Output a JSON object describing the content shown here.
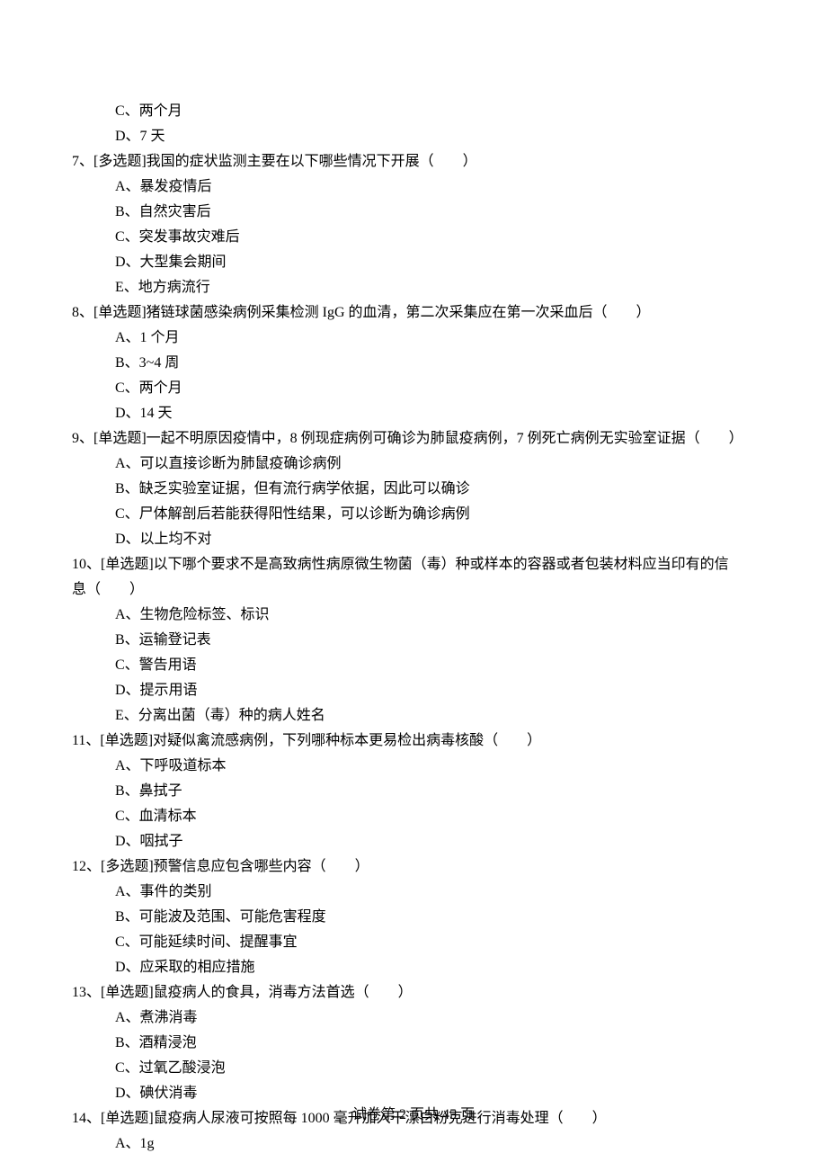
{
  "q6_tail": {
    "options": [
      {
        "label": "C、两个月"
      },
      {
        "label": "D、7 天"
      }
    ]
  },
  "q7": {
    "stem": "7、[多选题]我国的症状监测主要在以下哪些情况下开展（　　）",
    "options": [
      {
        "label": "A、暴发疫情后"
      },
      {
        "label": "B、自然灾害后"
      },
      {
        "label": "C、突发事故灾难后"
      },
      {
        "label": "D、大型集会期间"
      },
      {
        "label": "E、地方病流行"
      }
    ]
  },
  "q8": {
    "stem": "8、[单选题]猪链球菌感染病例采集检测 IgG 的血清，第二次采集应在第一次采血后（　　）",
    "options": [
      {
        "label": "A、1 个月"
      },
      {
        "label": "B、3~4 周"
      },
      {
        "label": "C、两个月"
      },
      {
        "label": "D、14 天"
      }
    ]
  },
  "q9": {
    "stem": "9、[单选题]一起不明原因疫情中，8 例现症病例可确诊为肺鼠疫病例，7 例死亡病例无实验室证据（　　）",
    "options": [
      {
        "label": "A、可以直接诊断为肺鼠疫确诊病例"
      },
      {
        "label": "B、缺乏实验室证据，但有流行病学依据，因此可以确诊"
      },
      {
        "label": "C、尸体解剖后若能获得阳性结果，可以诊断为确诊病例"
      },
      {
        "label": "D、以上均不对"
      }
    ]
  },
  "q10": {
    "stem_line1": "10、[单选题]以下哪个要求不是高致病性病原微生物菌（毒）种或样本的容器或者包装材料应当印有的信",
    "stem_line2": "息（　　）",
    "options": [
      {
        "label": "A、生物危险标签、标识"
      },
      {
        "label": "B、运输登记表"
      },
      {
        "label": "C、警告用语"
      },
      {
        "label": "D、提示用语"
      },
      {
        "label": "E、分离出菌（毒）种的病人姓名"
      }
    ]
  },
  "q11": {
    "stem": "11、[单选题]对疑似禽流感病例，下列哪种标本更易检出病毒核酸（　　）",
    "options": [
      {
        "label": "A、下呼吸道标本"
      },
      {
        "label": "B、鼻拭子"
      },
      {
        "label": "C、血清标本"
      },
      {
        "label": "D、咽拭子"
      }
    ]
  },
  "q12": {
    "stem": "12、[多选题]预警信息应包含哪些内容（　　）",
    "options": [
      {
        "label": "A、事件的类别"
      },
      {
        "label": "B、可能波及范围、可能危害程度"
      },
      {
        "label": "C、可能延续时间、提醒事宜"
      },
      {
        "label": "D、应采取的相应措施"
      }
    ]
  },
  "q13": {
    "stem": "13、[单选题]鼠疫病人的食具，消毒方法首选（　　）",
    "options": [
      {
        "label": "A、煮沸消毒"
      },
      {
        "label": "B、酒精浸泡"
      },
      {
        "label": "C、过氧乙酸浸泡"
      },
      {
        "label": "D、碘伏消毒"
      }
    ]
  },
  "q14": {
    "stem": "14、[单选题]鼠疫病人尿液可按照每 1000 毫升加入干漂白粉克进行消毒处理（　　）",
    "options": [
      {
        "label": "A、1g"
      }
    ]
  },
  "footer": "试卷第 2 页共 45 页"
}
